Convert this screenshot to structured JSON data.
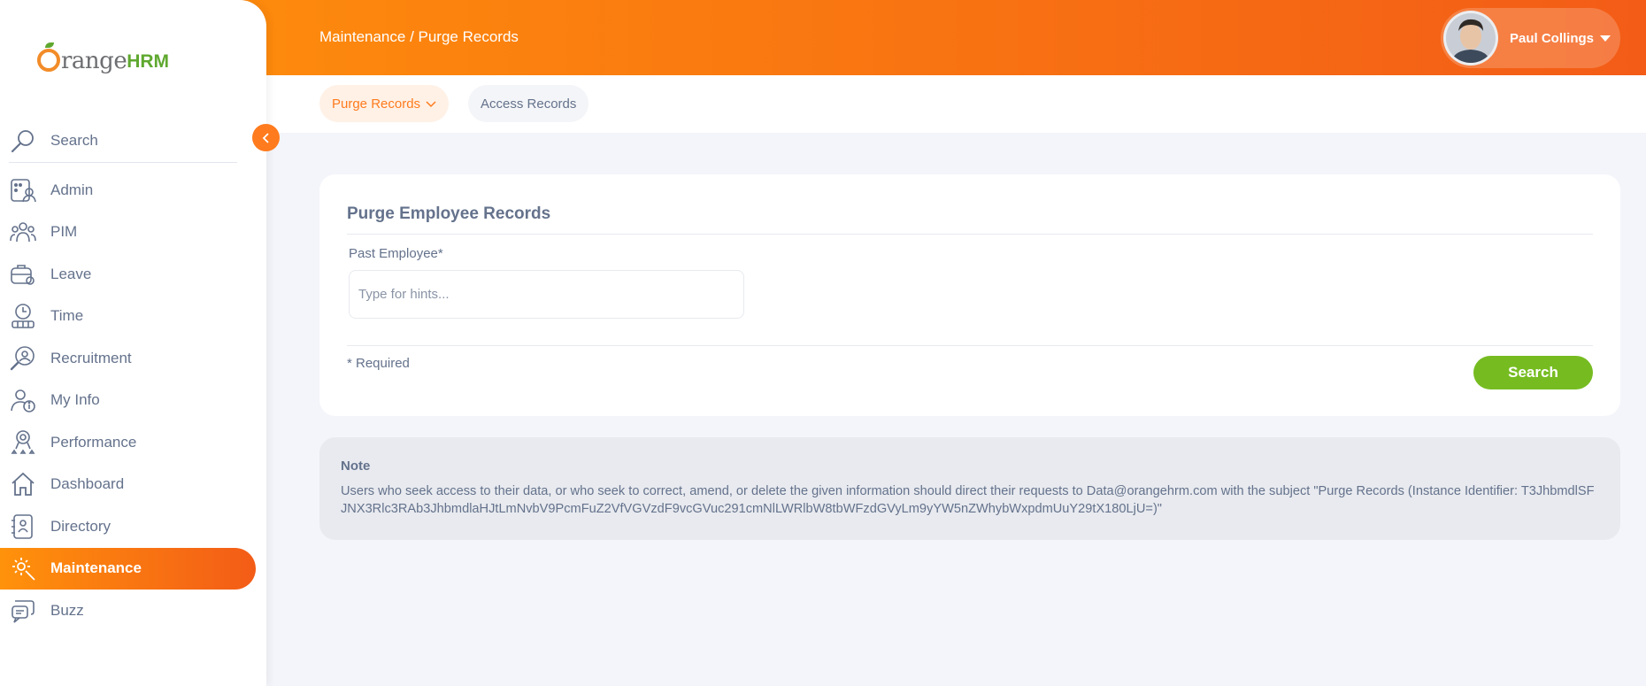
{
  "brand": {
    "orange": "range",
    "hrm": "HRM"
  },
  "sidebar": {
    "search_label": "Search",
    "items": [
      {
        "label": "Admin",
        "icon": "admin-icon"
      },
      {
        "label": "PIM",
        "icon": "pim-icon"
      },
      {
        "label": "Leave",
        "icon": "leave-icon"
      },
      {
        "label": "Time",
        "icon": "time-icon"
      },
      {
        "label": "Recruitment",
        "icon": "recruitment-icon"
      },
      {
        "label": "My Info",
        "icon": "my-info-icon"
      },
      {
        "label": "Performance",
        "icon": "performance-icon"
      },
      {
        "label": "Dashboard",
        "icon": "dashboard-icon"
      },
      {
        "label": "Directory",
        "icon": "directory-icon"
      },
      {
        "label": "Maintenance",
        "icon": "maintenance-icon",
        "active": true
      },
      {
        "label": "Buzz",
        "icon": "buzz-icon"
      }
    ]
  },
  "header": {
    "breadcrumb": "Maintenance / Purge Records",
    "user_name": "Paul Collings"
  },
  "tabs": [
    {
      "label": "Purge Records",
      "active": true
    },
    {
      "label": "Access Records",
      "active": false
    }
  ],
  "form": {
    "title": "Purge Employee Records",
    "field_label": "Past Employee*",
    "field_placeholder": "Type for hints...",
    "field_value": "",
    "required_note": "* Required",
    "submit_label": "Search"
  },
  "note": {
    "title": "Note",
    "body": "Users who seek access to their data, or who seek to correct, amend, or delete the given information should direct their requests to Data@orangehrm.com with the subject \"Purge Records (Instance Identifier: T3JhbmdlSFJNX3Rlc3RAb3JhbmdlaHJtLmNvbV9PcmFuZ2VfVGVzdF9vcGVuc291cmNlLWRlbW8tbWFzdGVyLm9yYW5nZWhybWxpdmUuY29tX180LjU=)\""
  },
  "colors": {
    "accent": "#ff7b1d",
    "accent_gradient_start": "#ff920b",
    "accent_gradient_end": "#f35c17",
    "success": "#76bc21",
    "text": "#64728c",
    "background": "#f4f5fa"
  }
}
